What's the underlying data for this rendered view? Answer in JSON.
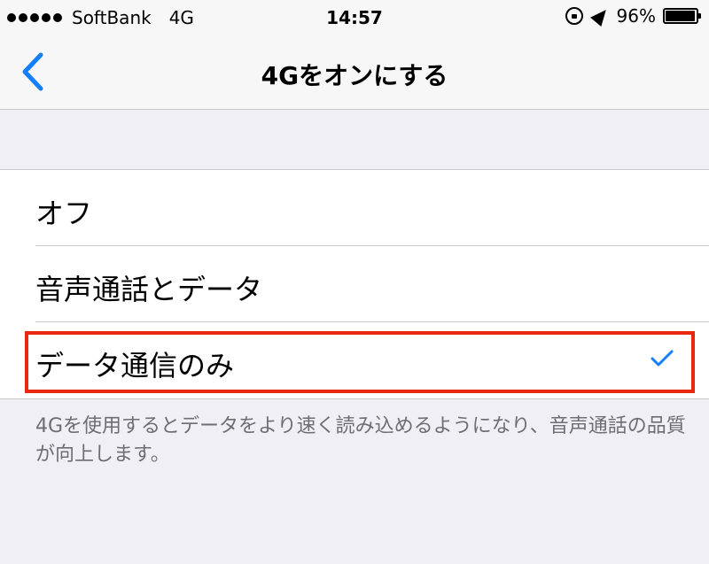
{
  "status_bar": {
    "carrier": "SoftBank",
    "network": "4G",
    "time": "14:57",
    "battery_percent": "96%",
    "battery_level": 0.96,
    "icons": [
      "signal-dots-icon",
      "rotation-lock-icon",
      "location-arrow-icon",
      "battery-icon"
    ]
  },
  "nav": {
    "back_icon": "chevron-left-icon",
    "title": "4Gをオンにする"
  },
  "options": [
    {
      "label": "オフ",
      "selected": false
    },
    {
      "label": "音声通話とデータ",
      "selected": false
    },
    {
      "label": "データ通信のみ",
      "selected": true
    }
  ],
  "footer_note": "4Gを使用するとデータをより速く読み込めるようになり、音声通話の品質が向上します。",
  "colors": {
    "accent": "#147efb",
    "highlight": "#e8290f",
    "background": "#efeff4"
  }
}
